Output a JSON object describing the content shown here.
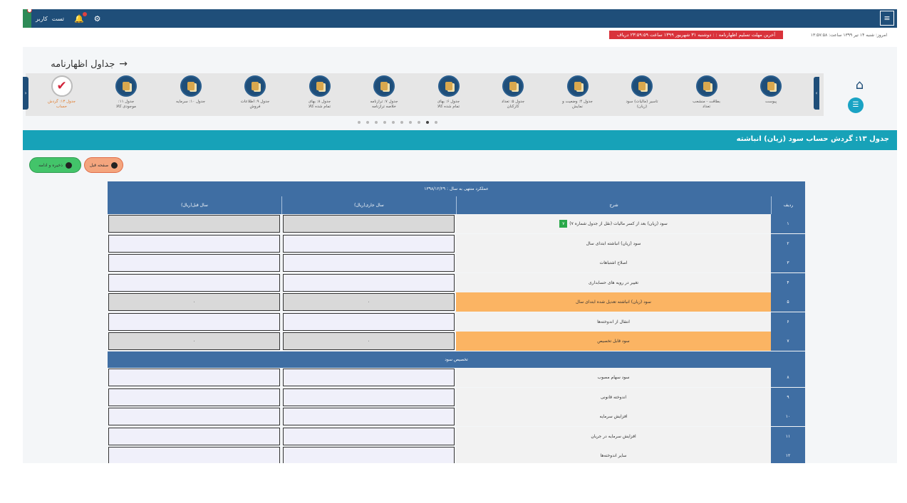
{
  "topbar": {
    "user_label": "کاربر",
    "username": "تست",
    "menu_icon": "≡"
  },
  "info": {
    "today": "امروز: شنبه ۱۴ تیر ۱۳۹۹ ساعت: ۱۳:۵۷:۵۸",
    "deadline": "آخرین مهلت تسلیم اظهارنامه : : دوشنبه ۳۱ شهریور ۱۳۹۹ ساعت ۲۳:۵۹:۵۹ دریاف"
  },
  "nav": {
    "title": "جداول اظهارنامه",
    "items": [
      {
        "label": "پیوست"
      },
      {
        "label": "بطاقت - منشعب",
        "sub": "تعداد"
      },
      {
        "label": "تاسیر (مالیات) سود",
        "sub": "(زیان)"
      },
      {
        "label": "جدول ۴: وضعیت و",
        "sub": "نمایش"
      },
      {
        "label": "جدول ۵: تعداد",
        "sub": "کارکنان"
      },
      {
        "label": "جدول ۶: بهای",
        "sub": "تمام شده کالا"
      },
      {
        "label": "جدول ۷: ترازنامه",
        "sub": "خلاصه ترازنامه"
      },
      {
        "label": "جدول ۸: بهای",
        "sub": "تمام شده کالا"
      },
      {
        "label": "جدول ۹: اطلاعات",
        "sub": "فروش"
      },
      {
        "label": "جدول ۱۰: سرمایه"
      },
      {
        "label": "جدول ۱۱:",
        "sub": "موجودی کالا"
      },
      {
        "label": "جدول ۱۳: گردش",
        "sub": "حساب"
      }
    ],
    "active_index": 11,
    "dots": 10,
    "active_dot": 8
  },
  "section": {
    "title": "جدول ۱۳: گردش حساب سود (زیان) انباشته"
  },
  "buttons": {
    "prev": "صفحه قبل",
    "save": "ذخیره و ادامه"
  },
  "table": {
    "period": "عملکرد منتهی به سال : ۱۳۹۸/۱۲/۲۹",
    "headers": {
      "idx": "ردیف",
      "desc": "شرح",
      "current": "سال جاری(ریال)",
      "previous": "سال قبل(ریال)"
    },
    "link_label": "۷",
    "rows": [
      {
        "idx": "۱",
        "desc": "سود (زیان) بعد از کسر مالیات (نقل از جدول شماره ۷)",
        "cur": "",
        "prev": "",
        "gray": true,
        "orange": false
      },
      {
        "idx": "۲",
        "desc": "سود (زیان) انباشته ابتدای سال",
        "cur": "",
        "prev": "",
        "gray": false,
        "orange": false
      },
      {
        "idx": "۳",
        "desc": "اصلاح اشتباهات",
        "cur": "",
        "prev": "",
        "gray": false,
        "orange": false
      },
      {
        "idx": "۴",
        "desc": "تغییر در رویه های حسابداری",
        "cur": "",
        "prev": "",
        "gray": false,
        "orange": false
      },
      {
        "idx": "۵",
        "desc": "سود (زیان) انباشته تعدیل شده ابتدای سال",
        "cur": "۰",
        "prev": "۰",
        "gray": true,
        "orange": true
      },
      {
        "idx": "۶",
        "desc": "انتقال از اندوخته‌ها",
        "cur": "",
        "prev": "",
        "gray": false,
        "orange": false
      },
      {
        "idx": "۷",
        "desc": "سود قابل تخصیص",
        "cur": "۰",
        "prev": "۰",
        "gray": true,
        "orange": true
      }
    ],
    "allocation_header": "تخصیص سود",
    "rows2": [
      {
        "idx": "۸",
        "desc": "سود سهام مصوب",
        "cur": "",
        "prev": ""
      },
      {
        "idx": "۹",
        "desc": "اندوخته قانونی",
        "cur": "",
        "prev": ""
      },
      {
        "idx": "۱۰",
        "desc": "افزایش سرمایه",
        "cur": "",
        "prev": ""
      },
      {
        "idx": "۱۱",
        "desc": "افزایش سرمایه در جریان",
        "cur": "",
        "prev": ""
      },
      {
        "idx": "۱۲",
        "desc": "سایر اندوخته‌ها",
        "cur": "",
        "prev": ""
      }
    ]
  },
  "colors": {
    "topbar": "#1f4e79",
    "section": "#17a2b8",
    "table_header": "#3f6ea3",
    "highlight": "#fbb463",
    "deadline": "#d9323a"
  }
}
